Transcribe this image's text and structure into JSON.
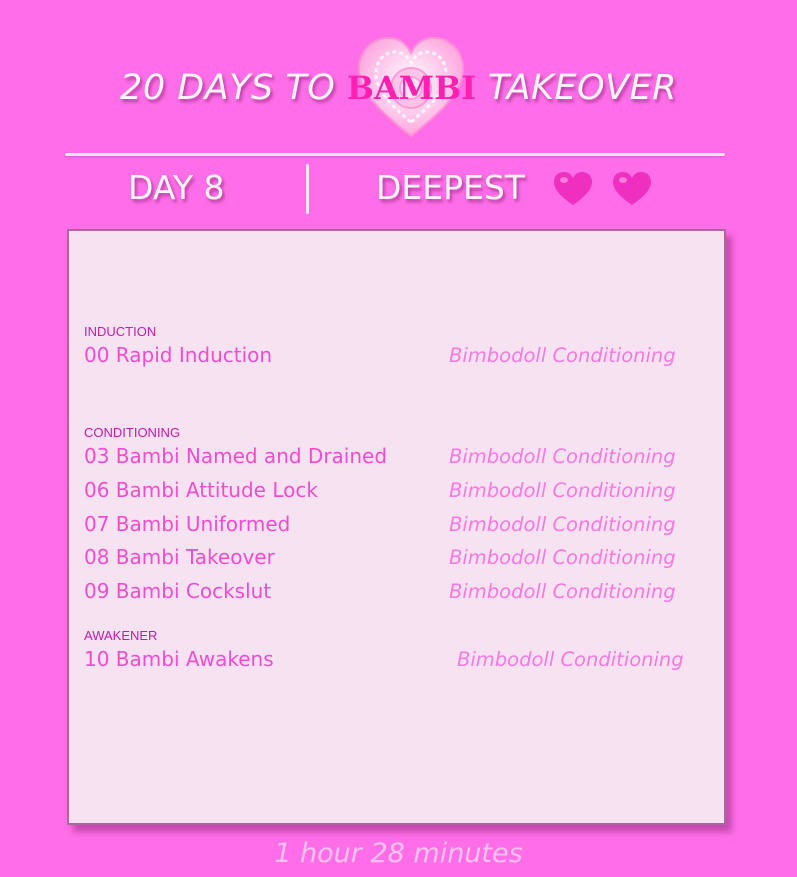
{
  "header": {
    "title_prefix": "20 DAYS TO ",
    "title_brand": "BAMBI",
    "title_suffix": " TAKEOVER",
    "logo_icon": "heart-logo-icon",
    "day": "DAY 8",
    "level": "DEEPEST",
    "level_icons": [
      "heart-icon",
      "heart-icon"
    ]
  },
  "playlist": {
    "sections": [
      {
        "label": "INDUCTION",
        "tracks": [
          {
            "title": "00 Rapid Induction",
            "source": "Bimbodoll Conditioning"
          }
        ]
      },
      {
        "label": "CONDITIONING",
        "tracks": [
          {
            "title": "03 Bambi Named and Drained",
            "source": "Bimbodoll Conditioning"
          },
          {
            "title": "06 Bambi Attitude Lock",
            "source": "Bimbodoll Conditioning"
          },
          {
            "title": "07 Bambi Uniformed",
            "source": "Bimbodoll Conditioning"
          },
          {
            "title": "08 Bambi Takeover",
            "source": "Bimbodoll Conditioning"
          },
          {
            "title": "09 Bambi Cockslut",
            "source": "Bimbodoll Conditioning"
          }
        ]
      },
      {
        "label": "AWAKENER",
        "tracks": [
          {
            "title": "10 Bambi Awakens",
            "source": "Bimbodoll Conditioning"
          }
        ]
      }
    ]
  },
  "footer": {
    "duration": "1 hour 28 minutes"
  },
  "colors": {
    "background": "#ff6ee8",
    "panel": "#f7e2f2",
    "brand": "#ff1fb0",
    "track_title": "#f14ccf",
    "track_source": "#fa78e0",
    "section_label": "#c11da7"
  }
}
